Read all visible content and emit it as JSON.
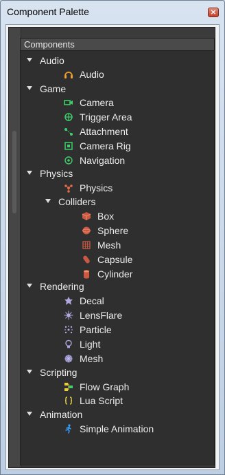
{
  "window": {
    "title": "Component Palette",
    "close_glyph": "×"
  },
  "tree": {
    "header": "Components",
    "groups": {
      "audio": {
        "label": "Audio",
        "items": [
          "Audio"
        ]
      },
      "game": {
        "label": "Game",
        "items": [
          "Camera",
          "Trigger Area",
          "Attachment",
          "Camera Rig",
          "Navigation"
        ]
      },
      "physics": {
        "label": "Physics",
        "items": [
          "Physics"
        ],
        "colliders": {
          "label": "Colliders",
          "items": [
            "Box",
            "Sphere",
            "Mesh",
            "Capsule",
            "Cylinder"
          ]
        }
      },
      "rendering": {
        "label": "Rendering",
        "items": [
          "Decal",
          "LensFlare",
          "Particle",
          "Light",
          "Mesh"
        ]
      },
      "scripting": {
        "label": "Scripting",
        "items": [
          "Flow Graph",
          "Lua Script"
        ]
      },
      "animation": {
        "label": "Animation",
        "items": [
          "Simple Animation"
        ]
      }
    }
  },
  "icons": {
    "audio": "headphones-icon",
    "camera": "camera-icon",
    "trigger_area": "trigger-area-icon",
    "attachment": "attachment-icon",
    "camera_rig": "camera-rig-icon",
    "navigation": "navigation-icon",
    "physics": "physics-icon",
    "box": "box-icon",
    "sphere": "sphere-icon",
    "mesh_collider": "mesh-collider-icon",
    "capsule": "capsule-icon",
    "cylinder": "cylinder-icon",
    "decal": "decal-icon",
    "lensflare": "lensflare-icon",
    "particle": "particle-icon",
    "light": "light-bulb-icon",
    "mesh_render": "mesh-render-icon",
    "flow_graph": "flow-graph-icon",
    "lua_script": "lua-script-icon",
    "simple_animation": "running-figure-icon"
  },
  "colors": {
    "panel_bg": "#2f2f2f",
    "text": "#ececec",
    "game_icon": "#3ecf6a",
    "physics_icon": "#e06a4a",
    "audio_icon": "#f0a030",
    "rendering_icon": "#b0a8e0",
    "scripting_icon": "#e6d040",
    "animation_icon": "#3aa0ff"
  }
}
